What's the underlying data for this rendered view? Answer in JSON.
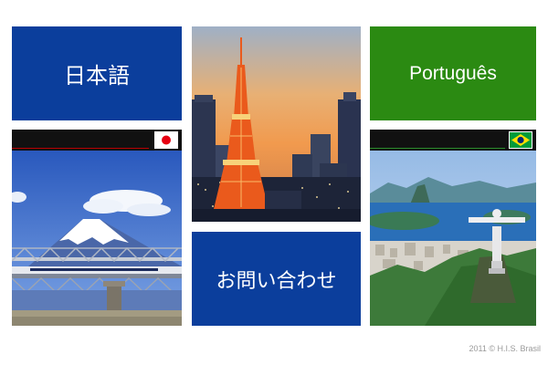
{
  "tiles": {
    "japanese_label": "日本語",
    "portuguese_label": "Português",
    "contact_label": "お問い合わせ"
  },
  "footer": {
    "copyright": "2011 © H.I.S. Brasil"
  },
  "colors": {
    "japanese_tile": "#0b3e9c",
    "portuguese_tile": "#2b8a12",
    "contact_tile": "#0b3e9c"
  },
  "icons": {
    "japan_flag": "japan-flag-icon",
    "brazil_flag": "brazil-flag-icon"
  }
}
